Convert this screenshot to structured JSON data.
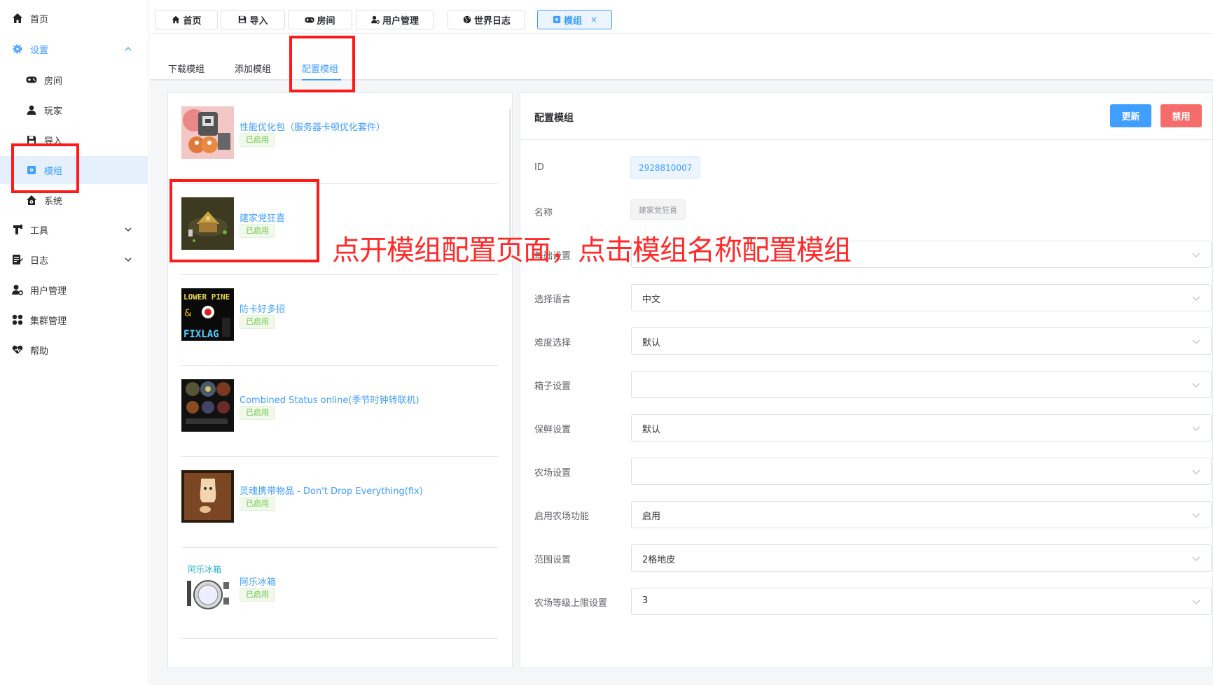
{
  "sidebar": {
    "items": [
      {
        "label": "首页",
        "icon": "home-icon"
      },
      {
        "label": "设置",
        "icon": "gear-icon",
        "expanded": true
      },
      {
        "label": "房间",
        "icon": "gamepad-icon"
      },
      {
        "label": "玩家",
        "icon": "user-icon"
      },
      {
        "label": "导入",
        "icon": "save-icon"
      },
      {
        "label": "模组",
        "icon": "puzzle-icon",
        "active": true
      },
      {
        "label": "系统",
        "icon": "house-gear-icon"
      },
      {
        "label": "工具",
        "icon": "tool-icon"
      },
      {
        "label": "日志",
        "icon": "log-icon"
      },
      {
        "label": "用户管理",
        "icon": "user-manage-icon"
      },
      {
        "label": "集群管理",
        "icon": "cluster-icon"
      },
      {
        "label": "帮助",
        "icon": "heart-help-icon"
      }
    ]
  },
  "tags": [
    {
      "label": "首页"
    },
    {
      "label": "导入"
    },
    {
      "label": "房间"
    },
    {
      "label": "用户管理"
    },
    {
      "label": "世界日志"
    },
    {
      "label": "模组",
      "close": "×"
    }
  ],
  "subtabs": [
    "下载模组",
    "添加模组",
    "配置模组"
  ],
  "mods": [
    {
      "name": "性能优化包（服务器卡顿优化套件）",
      "status": "已启用"
    },
    {
      "name": "建家党狂喜",
      "status": "已启用"
    },
    {
      "name": "防卡好多招",
      "status": "已启用"
    },
    {
      "name": "Combined Status online(季节时钟转联机)",
      "status": "已启用"
    },
    {
      "name": "灵魂携带物品 - Don't Drop Everything(fix)",
      "status": "已启用"
    },
    {
      "name": "阿乐冰箱",
      "status": "已启用"
    }
  ],
  "thumb_text": {
    "fixlag_top": "LOWER PINE",
    "fixlag_bottom": "FIXLAG",
    "fridge_title": "阿乐冰箱"
  },
  "config": {
    "title": "配置模组",
    "update_label": "更新",
    "disable_label": "禁用",
    "id_label": "ID",
    "id_value": "2928810007",
    "name_label": "名称",
    "name_value": "建家党狂喜",
    "rows": [
      {
        "label": "基础设置",
        "value": ""
      },
      {
        "label": "选择语言",
        "value": "中文"
      },
      {
        "label": "难度选择",
        "value": "默认"
      },
      {
        "label": "箱子设置",
        "value": ""
      },
      {
        "label": "保鲜设置",
        "value": "默认"
      },
      {
        "label": "农场设置",
        "value": ""
      },
      {
        "label": "启用农场功能",
        "value": "启用"
      },
      {
        "label": "范围设置",
        "value": "2格地皮"
      },
      {
        "label": "农场等级上限设置",
        "value": "3"
      }
    ]
  },
  "annotation": "点开模组配置页面，点击模组名称配置模组",
  "colors": {
    "accent": "#409eff",
    "danger": "#f56c6c",
    "success": "#67c23a",
    "annotation": "#ff1a1a"
  }
}
